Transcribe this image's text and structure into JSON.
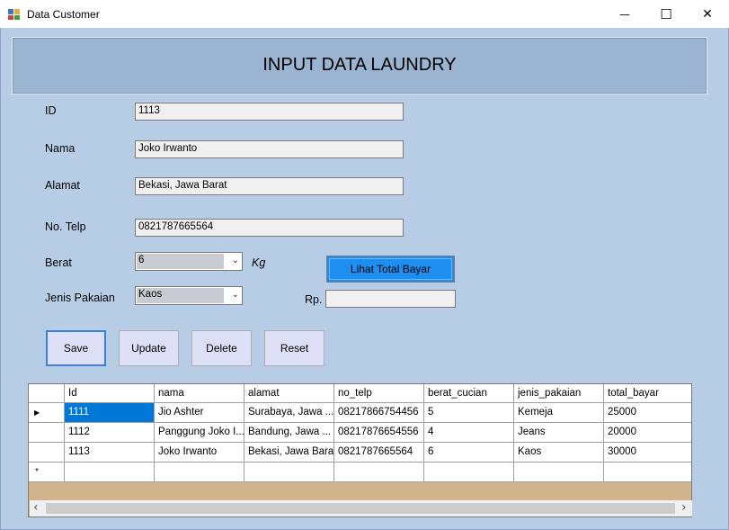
{
  "window": {
    "title": "Data Customer",
    "minimize_glyph": "—",
    "maximize_glyph": "☐",
    "close_glyph": "✕"
  },
  "header": {
    "title": "INPUT DATA LAUNDRY"
  },
  "form": {
    "id_label": "ID",
    "id_value": "1113",
    "nama_label": "Nama",
    "nama_value": "Joko Irwanto",
    "alamat_label": "Alamat",
    "alamat_value": "Bekasi, Jawa Barat",
    "telp_label": "No. Telp",
    "telp_value": "0821787665564",
    "berat_label": "Berat",
    "berat_value": "6",
    "berat_unit": "Kg",
    "jenis_label": "Jenis Pakaian",
    "jenis_value": "Kaos",
    "lihat_button": "Lihat Total Bayar",
    "rp_label": "Rp.",
    "rp_value": ""
  },
  "buttons": {
    "save": "Save",
    "update": "Update",
    "delete": "Delete",
    "reset": "Reset"
  },
  "table": {
    "columns": [
      "Id",
      "nama",
      "alamat",
      "no_telp",
      "berat_cucian",
      "jenis_pakaian",
      "total_bayar"
    ],
    "rows": [
      [
        "1111",
        "Jio Ashter",
        "Surabaya, Jawa ...",
        "08217866754456",
        "5",
        "Kemeja",
        "25000"
      ],
      [
        "1112",
        "Panggung Joko I...",
        "Bandung, Jawa ...",
        "08217876654556",
        "4",
        "Jeans",
        "20000"
      ],
      [
        "1113",
        "Joko Irwanto",
        "Bekasi, Jawa Barat",
        "0821787665564",
        "6",
        "Kaos",
        "30000"
      ]
    ],
    "current_row_marker": "▶",
    "new_row_marker": "*",
    "scroll_left_glyph": "‹",
    "scroll_right_glyph": "›"
  }
}
